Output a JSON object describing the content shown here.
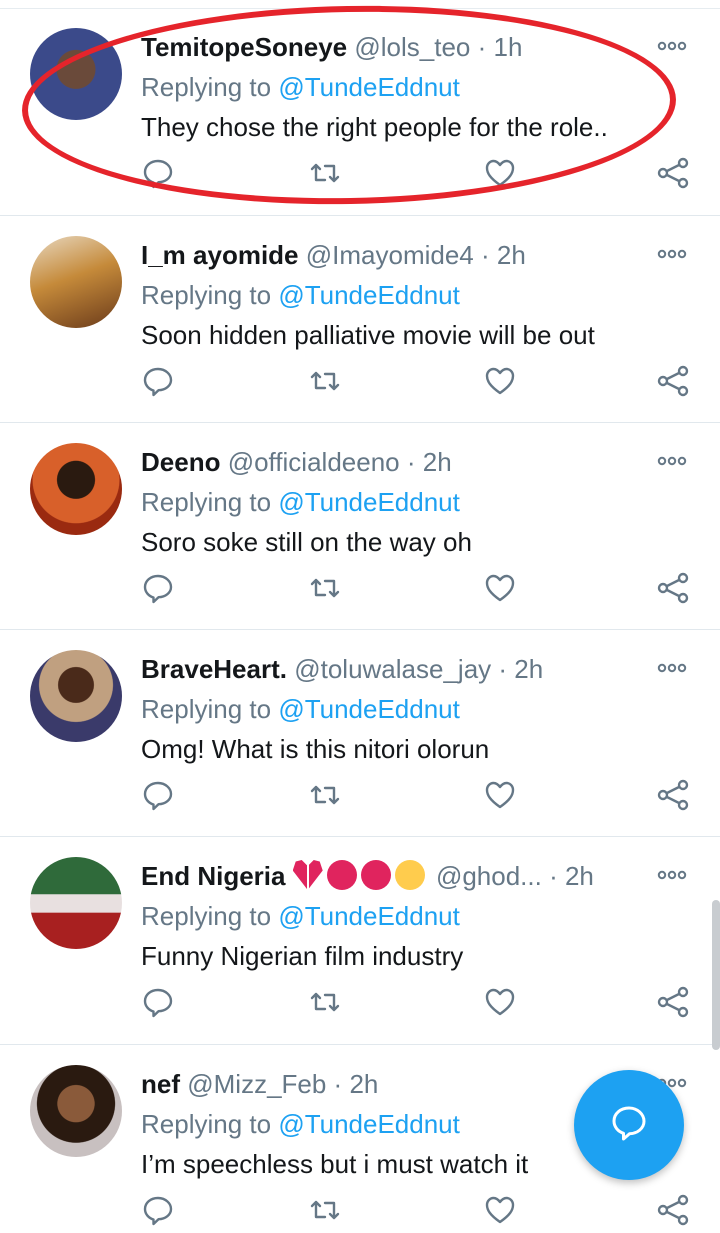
{
  "tweets": [
    {
      "name": "TemitopeSoneye",
      "handle": "@lols_teo",
      "sep": " · ",
      "time": "1h",
      "replying_prefix": "Replying to ",
      "replying_to": "@TundeEddnut",
      "text": "They chose the right people for the role..",
      "avatar_color": "#3b4a8a"
    },
    {
      "name": "I_m ayomide",
      "handle": "@Imayomide4",
      "sep": " · ",
      "time": "2h",
      "replying_prefix": "Replying to ",
      "replying_to": "@TundeEddnut",
      "text": "Soon hidden palliative movie will be out",
      "avatar_color": "#c58a3a"
    },
    {
      "name": "Deeno",
      "handle": "@officialdeeno",
      "sep": " · ",
      "time": "2h",
      "replying_prefix": "Replying to ",
      "replying_to": "@TundeEddnut",
      "text": "Soro soke still on the way oh",
      "avatar_color": "#b84a22"
    },
    {
      "name": "BraveHeart.",
      "handle": "@toluwalase_jay",
      "sep": " · ",
      "time": "2h",
      "replying_prefix": "Replying to ",
      "replying_to": "@TundeEddnut",
      "text": "Omg! What is this nitori olorun",
      "avatar_color": "#8a5a3a"
    },
    {
      "name": "End Nigeria",
      "handle": "@ghod...",
      "sep": " · ",
      "time": "2h",
      "replying_prefix": "Replying to ",
      "replying_to": "@TundeEddnut",
      "text": "Funny Nigerian film industry",
      "avatar_color": "#2f6a3a"
    },
    {
      "name": "nef",
      "handle": "@Mizz_Feb",
      "sep": " · ",
      "time": "2h",
      "replying_prefix": "Replying to ",
      "replying_to": "@TundeEddnut",
      "text": "I’m speechless but i must watch it",
      "avatar_color": "#5a3a2a"
    }
  ],
  "icons": {
    "more": "more-icon",
    "reply": "reply-icon",
    "retweet": "retweet-icon",
    "like": "like-icon",
    "share": "share-icon",
    "compose": "compose-icon"
  },
  "emojis": [
    "broken-heart",
    "cursing-face",
    "angry-face",
    "steam-nose-face"
  ],
  "colors": {
    "accent": "#1da1f2",
    "muted": "#657786",
    "annotation": "#e5242b"
  }
}
